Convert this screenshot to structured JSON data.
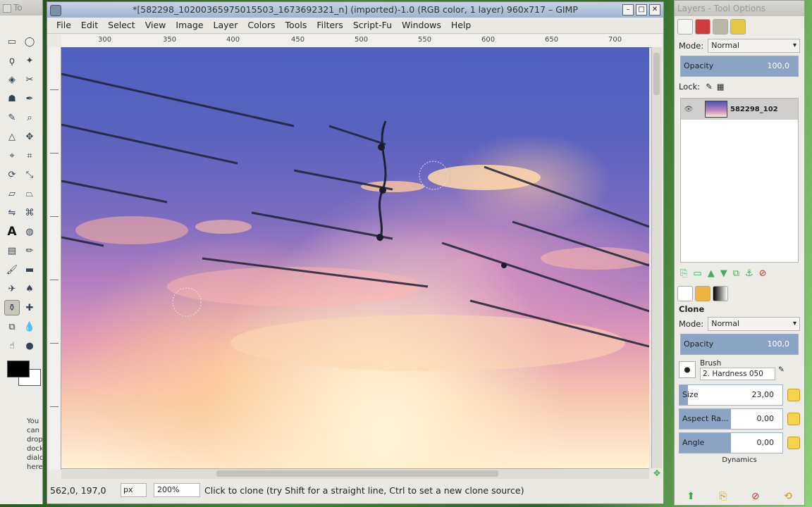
{
  "toolbox": {
    "title": "To",
    "hint_text": "You can drop dockable dialogs here"
  },
  "image_window": {
    "title": "*[582298_10200365975015503_1673692321_n] (imported)-1.0 (RGB color, 1 layer) 960x717 – GIMP",
    "menu": [
      "File",
      "Edit",
      "Select",
      "View",
      "Image",
      "Layer",
      "Colors",
      "Tools",
      "Filters",
      "Script-Fu",
      "Windows",
      "Help"
    ],
    "ruler_ticks": [
      "300",
      "350",
      "400",
      "450",
      "500",
      "550",
      "600",
      "650",
      "700"
    ],
    "status": {
      "coords": "562,0, 197,0",
      "unit": "px",
      "zoom": "200%",
      "message": "Click to clone (try Shift for a straight line, Ctrl to set a new clone source)"
    }
  },
  "layers_dock": {
    "title": "Layers - Tool Options",
    "mode_label": "Mode:",
    "mode_value": "Normal",
    "opacity_label": "Opacity",
    "opacity_value": "100,0",
    "lock_label": "Lock:",
    "layer_name": "582298_102"
  },
  "tool_options": {
    "tool_name": "Clone",
    "mode_label": "Mode:",
    "mode_value": "Normal",
    "opacity_label": "Opacity",
    "opacity_value": "100,0",
    "brush_label": "Brush",
    "brush_value": "2. Hardness 050",
    "size_label": "Size",
    "size_value": "23,00",
    "aspect_label": "Aspect Ra...",
    "aspect_value": "0,00",
    "angle_label": "Angle",
    "angle_value": "0,00",
    "dynamics_label": "Dynamics"
  },
  "colors": {
    "foreground": "#000000",
    "background": "#ffffff",
    "accent": "#8ca4c4"
  }
}
